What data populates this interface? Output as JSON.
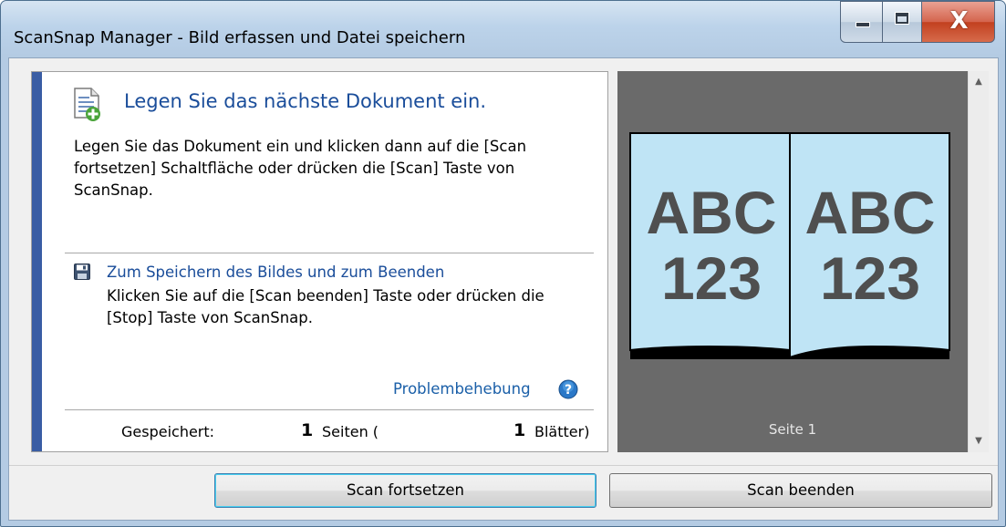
{
  "window": {
    "title": "ScanSnap Manager - Bild erfassen und Datei speichern",
    "close_glyph": "X"
  },
  "instructions": {
    "headline": "Legen Sie das nächste Dokument ein.",
    "body": "Legen Sie das Dokument ein und klicken dann auf die [Scan fortsetzen] Schaltfläche oder drücken die [Scan] Taste von ScanSnap.",
    "save_heading": "Zum Speichern des Bildes und zum Beenden",
    "save_body": "Klicken Sie auf die [Scan beenden] Taste oder drücken die [Stop] Taste von ScanSnap.",
    "troubleshooting_link": "Problembehebung"
  },
  "status": {
    "saved_label": "Gespeichert:",
    "pages_count": "1",
    "pages_label": "Seiten (",
    "sheets_count": "1",
    "sheets_label": "Blätter)"
  },
  "preview": {
    "left_page_line1": "ABC",
    "left_page_line2": "123",
    "right_page_line1": "ABC",
    "right_page_line2": "123",
    "page_caption": "Seite 1",
    "page_color": "#bfe4f5",
    "background_color": "#6a6a6a"
  },
  "buttons": {
    "continue_label": "Scan fortsetzen",
    "finish_label": "Scan beenden"
  },
  "colors": {
    "accent": "#3a5da4",
    "heading_text": "#1a4d9a",
    "link_text": "#1a5fa8"
  },
  "icons": {
    "document": "document-add-icon",
    "save": "floppy-disk-icon",
    "help": "help-icon",
    "scroll_up": "chevron-up-icon",
    "scroll_down": "chevron-down-icon"
  }
}
